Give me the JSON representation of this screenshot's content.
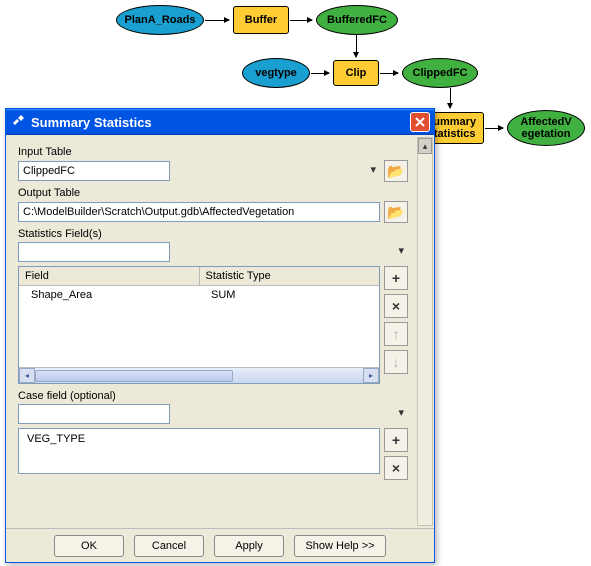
{
  "diagram": {
    "nodes": {
      "plana_roads": "PlanA_Roads",
      "buffer": "Buffer",
      "buffered_fc": "BufferedFC",
      "vegtype": "vegtype",
      "clip": "Clip",
      "clipped_fc": "ClippedFC",
      "summary_stats": "Summary\nStatistics",
      "affected_veg": "AffectedV\negetation"
    }
  },
  "dialog": {
    "title": "Summary Statistics",
    "labels": {
      "input_table": "Input Table",
      "output_table": "Output Table",
      "stats_fields": "Statistics Field(s)",
      "case_field": "Case field (optional)"
    },
    "inputs": {
      "input_table_value": "ClippedFC",
      "output_table_value": "C:\\ModelBuilder\\Scratch\\Output.gdb\\AffectedVegetation",
      "stats_combo_value": "",
      "case_combo_value": ""
    },
    "table": {
      "headers": {
        "field": "Field",
        "stat_type": "Statistic Type"
      },
      "rows": [
        {
          "field": "Shape_Area",
          "stat": "SUM"
        }
      ]
    },
    "case_items": [
      "VEG_TYPE"
    ],
    "buttons": {
      "ok": "OK",
      "cancel": "Cancel",
      "apply": "Apply",
      "show_help": "Show Help >>"
    }
  }
}
